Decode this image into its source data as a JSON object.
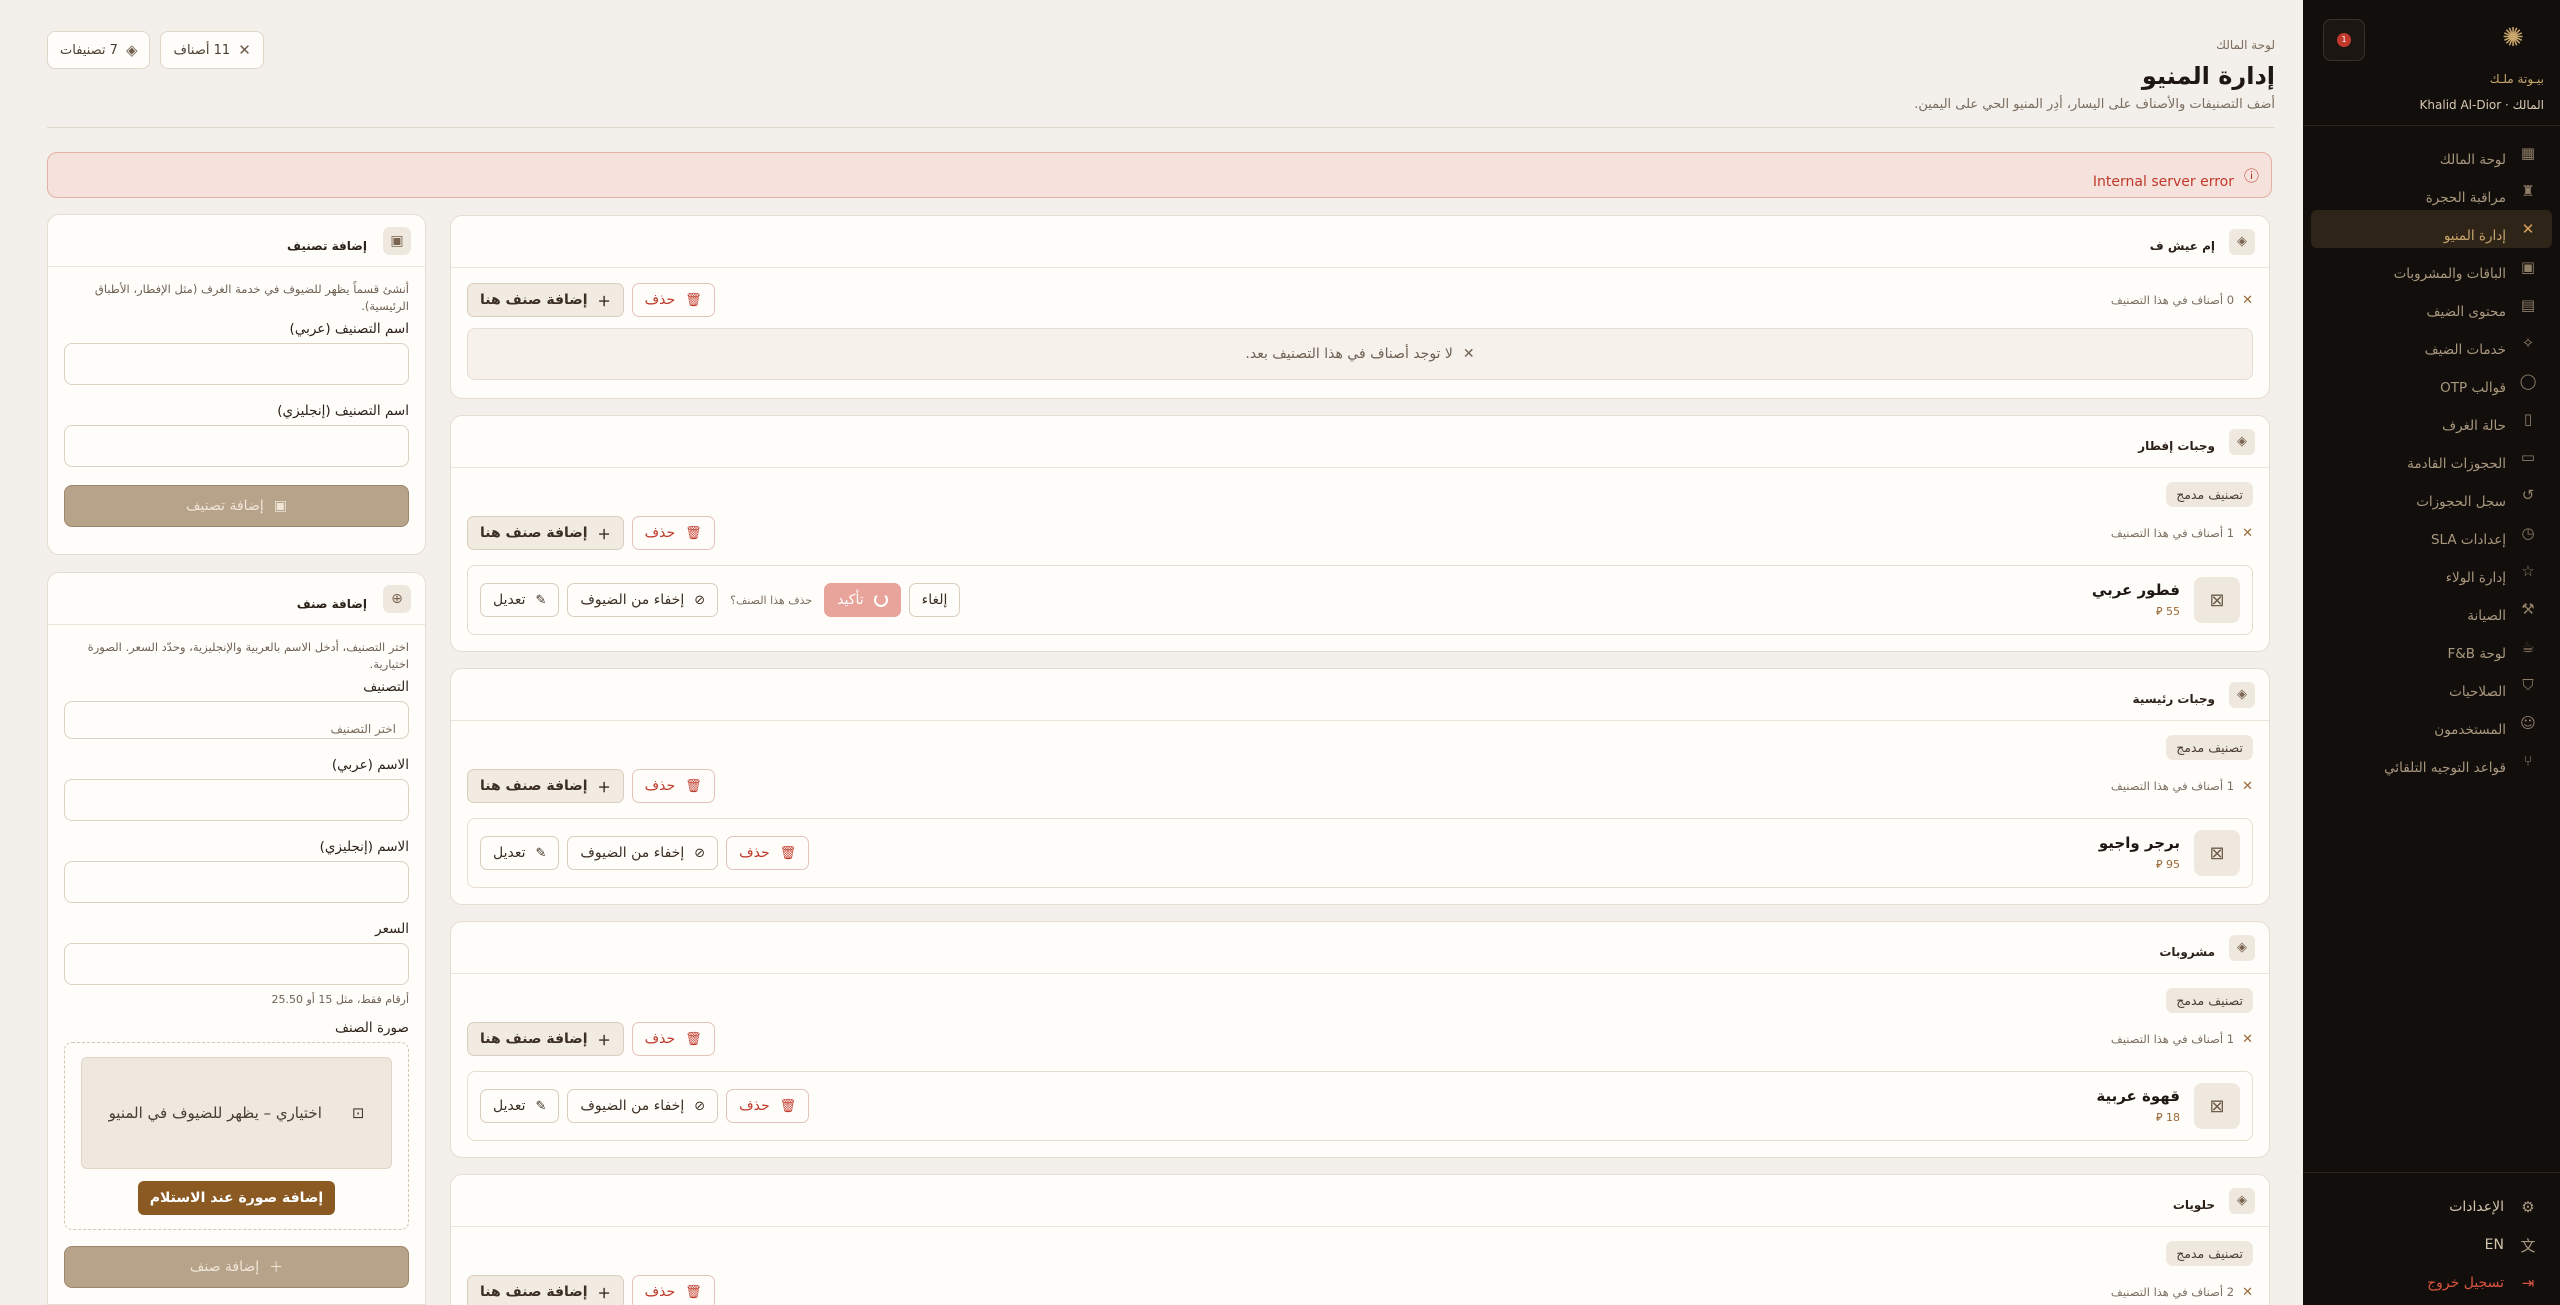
{
  "sidebar": {
    "hotel_name": "بيـوتة ملـك",
    "user": "المالك · Khalid Al-Dior",
    "notification_count": "1",
    "items": [
      {
        "label": "لوحة المالك",
        "icon": "grid-icon"
      },
      {
        "label": "مراقبة الحجرة",
        "icon": "hotel-icon"
      },
      {
        "label": "إدارة المنيو",
        "icon": "fork-knife-icon",
        "active": true
      },
      {
        "label": "الباقات والمشروبات",
        "icon": "gift-icon"
      },
      {
        "label": "محتوى الضيف",
        "icon": "document-icon"
      },
      {
        "label": "خدمات الضيف",
        "icon": "sparkle-icon"
      },
      {
        "label": "قوالب OTP",
        "icon": "chat-icon"
      },
      {
        "label": "حالة الغرف",
        "icon": "door-icon"
      },
      {
        "label": "الحجوزات القادمة",
        "icon": "calendar-icon"
      },
      {
        "label": "سجل الحجوزات",
        "icon": "history-icon"
      },
      {
        "label": "إعدادات SLA",
        "icon": "clock-icon"
      },
      {
        "label": "إدارة الولاء",
        "icon": "star-icon"
      },
      {
        "label": "الصيانة",
        "icon": "wrench-icon"
      },
      {
        "label": "لوحة F&B",
        "icon": "cup-icon"
      },
      {
        "label": "الصلاحيات",
        "icon": "shield-icon"
      },
      {
        "label": "المستخدمون",
        "icon": "users-icon"
      },
      {
        "label": "قواعد التوجيه التلقائي",
        "icon": "route-icon"
      }
    ],
    "settings": "الإعدادات",
    "language": "EN",
    "logout": "تسجيل خروج"
  },
  "header": {
    "breadcrumb": "لوحة المالك",
    "title": "إدارة المنيو",
    "subtitle": "أضف التصنيفات والأصناف على اليسار، أدِر المنيو الحي على اليمين.",
    "chip_categories": "7 تصنيفات",
    "chip_items": "11 أصناف"
  },
  "error": {
    "message": "Internal server error"
  },
  "labels": {
    "add_item_here": "إضافة صنف هنا",
    "delete": "حذف",
    "merged_category": "تصنيف مدمج",
    "edit": "تعديل",
    "hide_from_guests": "إخفاء من الضيوف",
    "confirm": "تأكيد",
    "cancel": "إلغاء",
    "delete_question": "حذف هذا الصنف؟",
    "no_items": "لا توجد أصناف في هذا التصنيف بعد."
  },
  "categories": [
    {
      "name": "إم عيش ف",
      "count": "0 أصناف في هذا التصنيف",
      "merged": false,
      "items": []
    },
    {
      "name": "وجبات إفطار",
      "count": "1 أصناف في هذا التصنيف",
      "merged": true,
      "items": [
        {
          "name": "فطور عربي",
          "price": "55 ⃁",
          "confirming": true
        }
      ]
    },
    {
      "name": "وجبات رئيسية",
      "count": "1 أصناف في هذا التصنيف",
      "merged": true,
      "items": [
        {
          "name": "برجر واجيو",
          "price": "95 ⃁",
          "confirming": false
        }
      ]
    },
    {
      "name": "مشروبات",
      "count": "1 أصناف في هذا التصنيف",
      "merged": true,
      "items": [
        {
          "name": "قهوة عربية",
          "price": "18 ⃁",
          "confirming": false
        }
      ]
    },
    {
      "name": "حلويات",
      "count": "2 أصناف في هذا التصنيف",
      "merged": true,
      "items": []
    }
  ],
  "add_category": {
    "title": "إضافة تصنيف",
    "hint": "أنشئ قسماً يظهر للضيوف في خدمة الغرف (مثل الإفطار، الأطباق الرئيسية).",
    "name_ar_label": "اسم التصنيف (عربي)",
    "name_en_label": "اسم التصنيف (إنجليزي)",
    "name_ar_value": "",
    "name_en_value": "",
    "submit": "إضافة تصنيف"
  },
  "add_item": {
    "title": "إضافة صنف",
    "hint": "اختر التصنيف، أدخل الاسم بالعربية والإنجليزية، وحدّد السعر. الصورة اختيارية.",
    "category_label": "التصنيف",
    "category_value": "اختر التصنيف",
    "name_ar_label": "الاسم (عربي)",
    "name_en_label": "الاسم (إنجليزي)",
    "price_label": "السعر",
    "price_hint": "أرقام فقط، مثل 15 أو 25.50",
    "image_label": "صورة الصنف",
    "image_placeholder": "اختياري – يظهر للضيوف في المنيو",
    "upload_button": "إضافة صورة عند الاستلام",
    "submit": "إضافة صنف"
  }
}
